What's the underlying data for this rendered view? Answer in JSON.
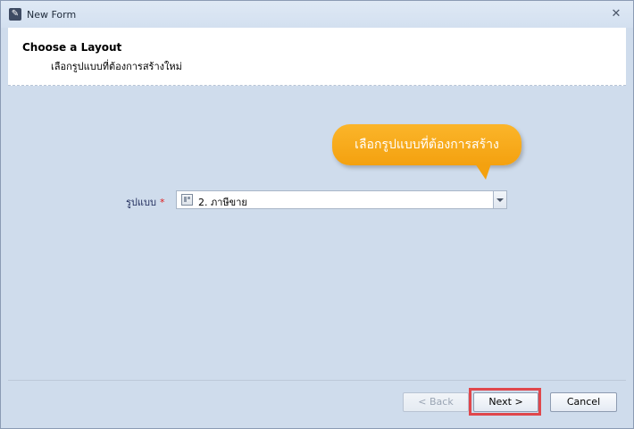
{
  "window": {
    "title": "New Form"
  },
  "header": {
    "title": "Choose a Layout",
    "subtitle": "เลือกรูปแบบที่ต้องการสร้างใหม่"
  },
  "tooltip": {
    "text": "เลือกรูปแบบที่ต้องการสร้าง"
  },
  "form": {
    "layout_label": "รูปแบบ",
    "required_mark": "*",
    "layout_value": "2. ภาษีขาย"
  },
  "footer": {
    "back_label": "< Back",
    "next_label": "Next >",
    "cancel_label": "Cancel"
  },
  "colors": {
    "tooltip": "#f4a10f",
    "highlight": "#e0474c",
    "required": "#e01b1b"
  }
}
